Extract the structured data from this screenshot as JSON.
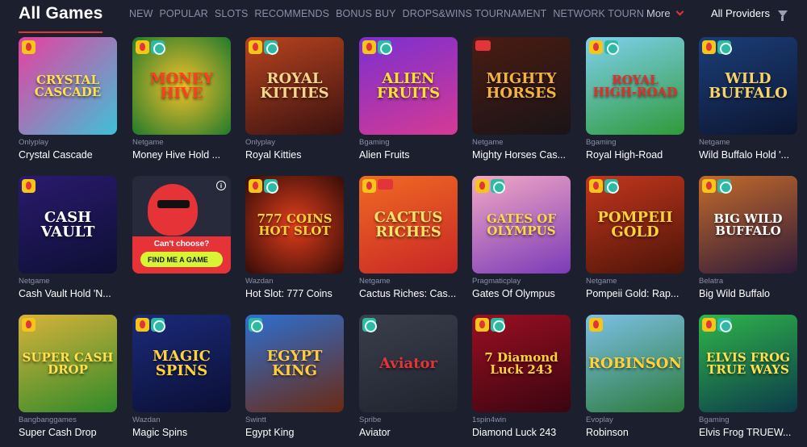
{
  "header": {
    "title": "All Games",
    "nav": [
      "NEW",
      "POPULAR",
      "SLOTS",
      "RECOMMENDS",
      "BONUS BUY",
      "DROPS&WINS TOURNAMENT",
      "NETWORK TOURN"
    ],
    "more_label": "More",
    "providers_label": "All Providers"
  },
  "promo": {
    "question": "Can't choose?",
    "button": "FIND ME A GAME",
    "info": "i"
  },
  "games": [
    {
      "provider": "Onlyplay",
      "name": "Crystal Cascade",
      "art": "CRYSTAL CASCADE",
      "bg": "linear-gradient(135deg,#e93fa0,#3ec1d6)",
      "color": "#ffe14d",
      "badges": [
        "fire"
      ]
    },
    {
      "provider": "Netgame",
      "name": "Money Hive Hold ...",
      "art": "MONEY HIVE",
      "bg": "radial-gradient(circle,#f4c12a,#1f7a2c)",
      "color": "#ff3d1f",
      "badges": [
        "fire",
        "buy"
      ]
    },
    {
      "provider": "Onlyplay",
      "name": "Royal Kitties",
      "art": "ROYAL KITTIES",
      "bg": "linear-gradient(160deg,#b8431f,#3a1210)",
      "color": "#f7d58a",
      "badges": [
        "fire",
        "buy"
      ]
    },
    {
      "provider": "Bgaming",
      "name": "Alien Fruits",
      "art": "ALIEN FRUITS",
      "bg": "linear-gradient(160deg,#7b2fd1,#d53a93)",
      "color": "#ffe22e",
      "badges": [
        "fire",
        "buy"
      ]
    },
    {
      "provider": "Netgame",
      "name": "Mighty Horses Cas...",
      "art": "MIGHTY HORSES",
      "bg": "linear-gradient(160deg,#4a1c12,#1a1418)",
      "color": "#f2b441",
      "badges": [
        "new"
      ]
    },
    {
      "provider": "Bgaming",
      "name": "Royal High-Road",
      "art": "ROYAL HIGH-ROAD",
      "bg": "linear-gradient(160deg,#7fd0ee,#2f9a3a)",
      "color": "#e72a2a",
      "badges": [
        "fire",
        "buy"
      ]
    },
    {
      "provider": "Netgame",
      "name": "Wild Buffalo Hold '...",
      "art": "WILD BUFFALO",
      "bg": "linear-gradient(160deg,#1b3e78,#0c1530)",
      "color": "#f5d36a",
      "badges": [
        "fire",
        "buy"
      ]
    },
    {
      "provider": "Netgame",
      "name": "Cash Vault Hold 'N...",
      "art": "CASH VAULT",
      "bg": "linear-gradient(160deg,#2a1a6e,#0d0f33)",
      "color": "#ffffff",
      "badges": [
        "fire"
      ]
    },
    {
      "promo": true
    },
    {
      "provider": "Wazdan",
      "name": "Hot Slot: 777 Coins",
      "art": "777 COINS HOT SLOT",
      "bg": "radial-gradient(circle,#e33e1c,#330c08)",
      "color": "#ffd23a",
      "badges": [
        "fire",
        "buy"
      ]
    },
    {
      "provider": "Netgame",
      "name": "Cactus Riches: Cas...",
      "art": "CACTUS RICHES",
      "bg": "linear-gradient(160deg,#f16a23,#c72626)",
      "color": "#ffe06a",
      "badges": [
        "fire",
        "new"
      ]
    },
    {
      "provider": "Pragmaticplay",
      "name": "Gates Of Olympus",
      "art": "GATES OF OLYMPUS",
      "bg": "linear-gradient(160deg,#f3a7c4,#7a3bb8)",
      "color": "#ffd84a",
      "badges": [
        "fire",
        "buy"
      ]
    },
    {
      "provider": "Netgame",
      "name": "Pompeii Gold: Rap...",
      "art": "POMPEII GOLD",
      "bg": "linear-gradient(160deg,#c4361d,#4b1408)",
      "color": "#ffd23a",
      "badges": [
        "fire",
        "buy"
      ]
    },
    {
      "provider": "Belatra",
      "name": "Big Wild Buffalo",
      "art": "BIG WILD BUFFALO",
      "bg": "linear-gradient(160deg,#c46a2a,#2d1a3a)",
      "color": "#ffffff",
      "badges": [
        "fire",
        "buy"
      ]
    },
    {
      "provider": "Bangbanggames",
      "name": "Super Cash Drop",
      "art": "SUPER CASH DROP",
      "bg": "linear-gradient(160deg,#d8b23a,#2f8a2a)",
      "color": "#ffe14d",
      "badges": [
        "fire"
      ]
    },
    {
      "provider": "Wazdan",
      "name": "Magic Spins",
      "art": "MAGIC SPINS",
      "bg": "linear-gradient(160deg,#1a2a7a,#0b0f33)",
      "color": "#ffd23a",
      "badges": [
        "fire",
        "buy"
      ]
    },
    {
      "provider": "Swintt",
      "name": "Egypt King",
      "art": "EGYPT KING",
      "bg": "linear-gradient(160deg,#2d6fd1,#6b2a12)",
      "color": "#ffcc3a",
      "badges": [
        "buy"
      ]
    },
    {
      "provider": "Spribe",
      "name": "Aviator",
      "art": "Aviator",
      "bg": "linear-gradient(160deg,#3a3f4c,#20232e)",
      "color": "#e2353a",
      "badges": [
        "buy"
      ]
    },
    {
      "provider": "1spin4win",
      "name": "Diamond Luck 243",
      "art": "7 Diamond Luck 243",
      "bg": "linear-gradient(160deg,#9a0f22,#3a0510)",
      "color": "#ffd23a",
      "badges": [
        "fire",
        "buy"
      ]
    },
    {
      "provider": "Evoplay",
      "name": "Robinson",
      "art": "ROBINSON",
      "bg": "linear-gradient(160deg,#7cc0e6,#2b7a3a)",
      "color": "#ffd23a",
      "badges": [
        "fire"
      ]
    },
    {
      "provider": "Bgaming",
      "name": "Elvis Frog TRUEW...",
      "art": "ELVIS FROG TRUE WAYS",
      "bg": "linear-gradient(160deg,#2fb54a,#0c3a4a)",
      "color": "#ffe14d",
      "badges": [
        "fire",
        "buy"
      ]
    }
  ]
}
